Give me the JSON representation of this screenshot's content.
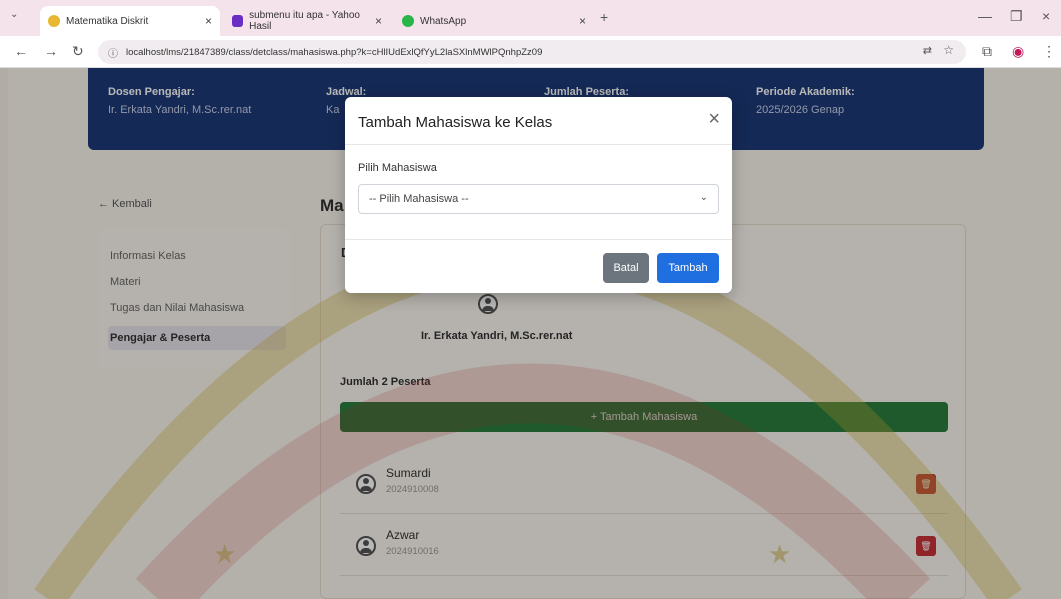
{
  "browser": {
    "tabs": [
      {
        "label": "Matematika Diskrit",
        "active": true
      },
      {
        "label": "submenu itu apa - Yahoo Hasil",
        "active": false
      },
      {
        "label": "WhatsApp",
        "active": false
      }
    ],
    "url": "localhost/lms/21847389/class/detclass/mahasiswa.php?k=cHlIUdExlQfYyL2laSXlnMWlPQnhpZz09",
    "new_tab_icon": "+",
    "close_icon": "×"
  },
  "banner": {
    "dosen_label": "Dosen Pengajar:",
    "dosen_value": "Ir. Erkata Yandri, M.Sc.rer.nat",
    "jadwal_label": "Jadwal:",
    "jadwal_value": "Ka",
    "peserta_label": "Jumlah Peserta:",
    "periode_label": "Periode Akademik:",
    "periode_value": "2025/2026 Genap"
  },
  "sidebar": {
    "back_label": "← Kembali",
    "items": [
      {
        "label": "Informasi Kelas"
      },
      {
        "label": "Materi"
      },
      {
        "label": "Tugas dan Nilai Mahasiswa"
      },
      {
        "label": "Pengajar & Peserta",
        "active": true
      }
    ]
  },
  "main": {
    "title": "Ma",
    "section_initial": "D",
    "teacher_name": "Ir. Erkata Yandri, M.Sc.rer.nat",
    "participants_count_label": "Jumlah 2 Peserta",
    "add_button_label": "+ Tambah Mahasiswa",
    "students": [
      {
        "name": "Sumardi",
        "nim": "2024910008"
      },
      {
        "name": "Azwar",
        "nim": "2024910016"
      }
    ]
  },
  "modal": {
    "title": "Tambah Mahasiswa ke Kelas",
    "field_label": "Pilih Mahasiswa",
    "select_value": "-- Pilih Mahasiswa --",
    "cancel_label": "Batal",
    "submit_label": "Tambah"
  },
  "colors": {
    "banner": "#1e3a78",
    "green": "#2a7d3c",
    "danger": "#c8323a",
    "primary": "#1f6fe0",
    "secondary": "#6c757d"
  }
}
